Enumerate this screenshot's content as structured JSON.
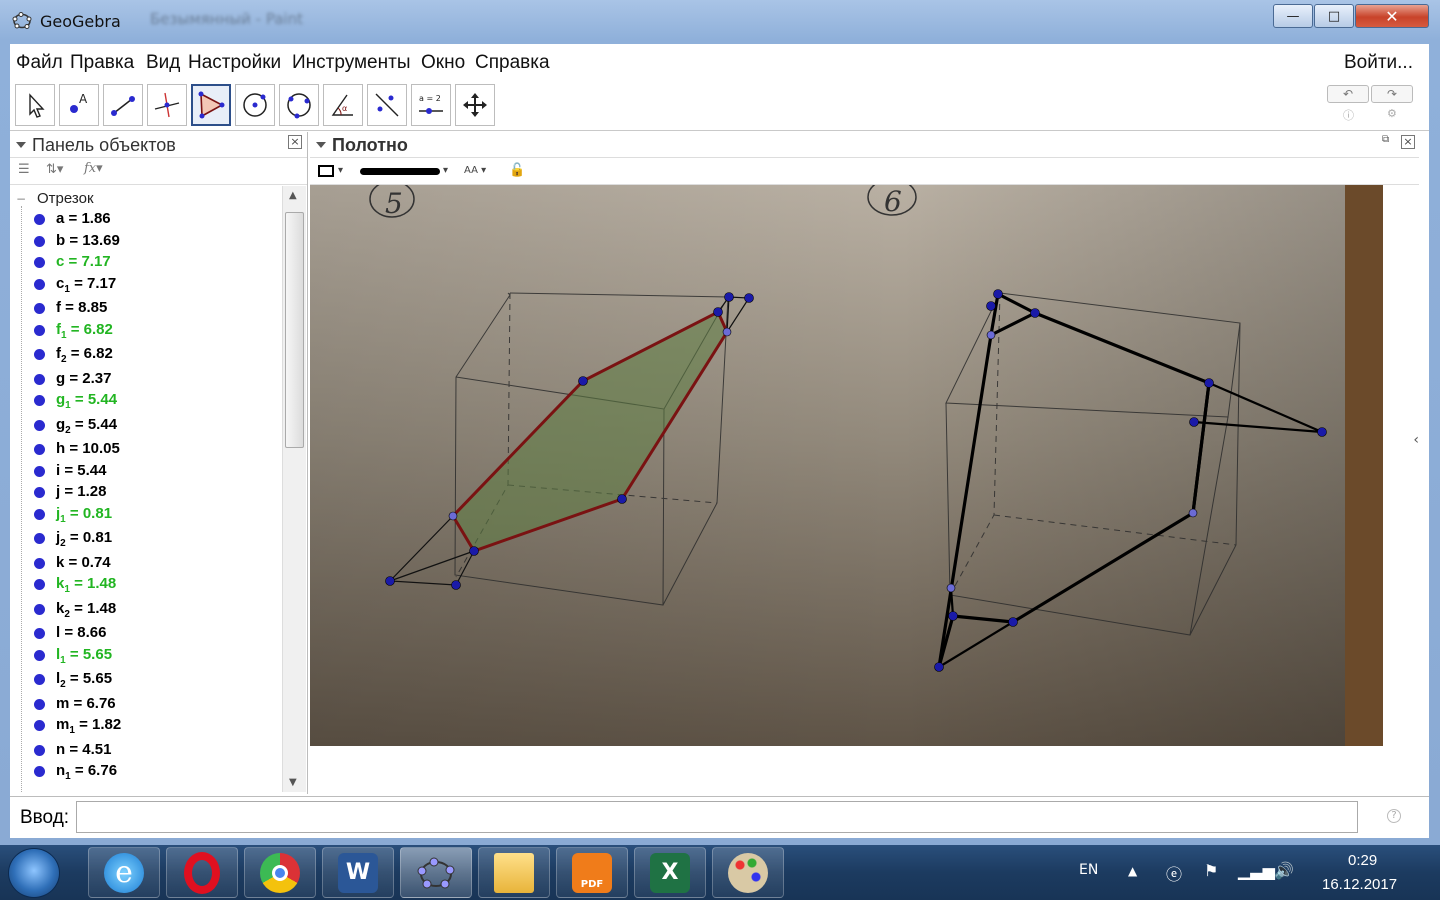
{
  "window": {
    "title": "GeoGebra",
    "background_title": "Безымянный - Paint",
    "minimize": "—",
    "maximize": "□",
    "close": "✕"
  },
  "menu": {
    "items": [
      "Файл",
      "Правка",
      "Вид",
      "Настройки",
      "Инструменты",
      "Окно",
      "Справка"
    ],
    "login": "Войти..."
  },
  "toolbar": {
    "tools": [
      "move-tool",
      "point-tool",
      "line-tool",
      "perpendicular-tool",
      "polygon-tool",
      "circle-tool",
      "conic-tool",
      "angle-tool",
      "reflect-tool",
      "slider-tool",
      "move-graphics-tool"
    ],
    "active_tool": "polygon-tool",
    "slider_label": "a = 2"
  },
  "algebra": {
    "title": "Панель объектов",
    "group": "Отрезок",
    "items": [
      {
        "name": "a",
        "sub": "",
        "value": "1.86",
        "color": "#000000"
      },
      {
        "name": "b",
        "sub": "",
        "value": "13.69",
        "color": "#000000"
      },
      {
        "name": "c",
        "sub": "",
        "value": "7.17",
        "color": "#22b522"
      },
      {
        "name": "c",
        "sub": "1",
        "value": "7.17",
        "color": "#000000"
      },
      {
        "name": "f",
        "sub": "",
        "value": "8.85",
        "color": "#000000"
      },
      {
        "name": "f",
        "sub": "1",
        "value": "6.82",
        "color": "#22b522"
      },
      {
        "name": "f",
        "sub": "2",
        "value": "6.82",
        "color": "#000000"
      },
      {
        "name": "g",
        "sub": "",
        "value": "2.37",
        "color": "#000000"
      },
      {
        "name": "g",
        "sub": "1",
        "value": "5.44",
        "color": "#22b522"
      },
      {
        "name": "g",
        "sub": "2",
        "value": "5.44",
        "color": "#000000"
      },
      {
        "name": "h",
        "sub": "",
        "value": "10.05",
        "color": "#000000"
      },
      {
        "name": "i",
        "sub": "",
        "value": "5.44",
        "color": "#000000"
      },
      {
        "name": "j",
        "sub": "",
        "value": "1.28",
        "color": "#000000"
      },
      {
        "name": "j",
        "sub": "1",
        "value": "0.81",
        "color": "#22b522"
      },
      {
        "name": "j",
        "sub": "2",
        "value": "0.81",
        "color": "#000000"
      },
      {
        "name": "k",
        "sub": "",
        "value": "0.74",
        "color": "#000000"
      },
      {
        "name": "k",
        "sub": "1",
        "value": "1.48",
        "color": "#22b522"
      },
      {
        "name": "k",
        "sub": "2",
        "value": "1.48",
        "color": "#000000"
      },
      {
        "name": "l",
        "sub": "",
        "value": "8.66",
        "color": "#000000"
      },
      {
        "name": "l",
        "sub": "1",
        "value": "5.65",
        "color": "#22b522"
      },
      {
        "name": "l",
        "sub": "2",
        "value": "5.65",
        "color": "#000000"
      },
      {
        "name": "m",
        "sub": "",
        "value": "6.76",
        "color": "#000000"
      },
      {
        "name": "m",
        "sub": "1",
        "value": "1.82",
        "color": "#000000"
      },
      {
        "name": "n",
        "sub": "",
        "value": "4.51",
        "color": "#000000"
      },
      {
        "name": "n",
        "sub": "1",
        "value": "6.76",
        "color": "#000000"
      }
    ]
  },
  "graphics": {
    "title": "Полотно",
    "labels": [
      "5",
      "6"
    ]
  },
  "input": {
    "label": "Ввод:",
    "value": ""
  },
  "taskbar": {
    "apps": [
      "internet-explorer",
      "opera",
      "chrome",
      "word",
      "geogebra",
      "explorer",
      "pdf-reader",
      "excel",
      "paint"
    ],
    "lang": "EN",
    "time": "0:29",
    "date": "16.12.2017"
  },
  "colors": {
    "accent": "#2d4f8a",
    "point": "#1a1aa8",
    "polygon_fill": "#6b8a52",
    "polygon_edge": "#7a1212",
    "green_text": "#22b522"
  }
}
